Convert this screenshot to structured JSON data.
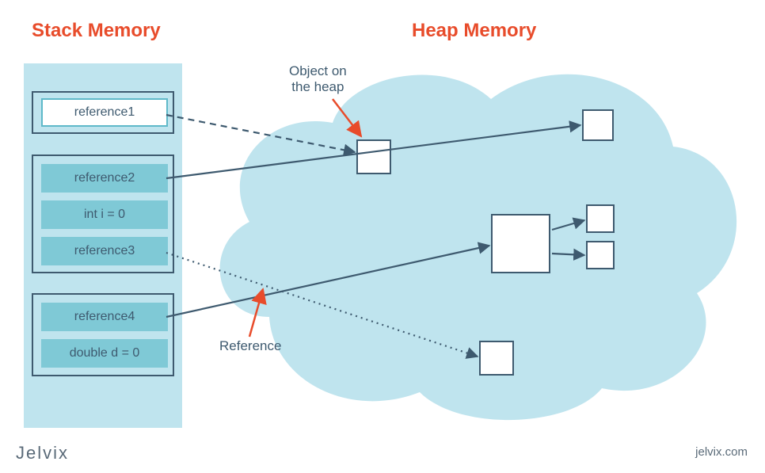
{
  "titles": {
    "stack": "Stack Memory",
    "heap": "Heap Memory"
  },
  "stack": {
    "frame1": {
      "ref1": "reference1"
    },
    "frame2": {
      "ref2": "reference2",
      "int": "int i = 0",
      "ref3": "reference3"
    },
    "frame3": {
      "ref4": "reference4",
      "dbl": "double d = 0"
    }
  },
  "annotations": {
    "object_on_heap_line1": "Object on",
    "object_on_heap_line2": "the heap",
    "reference": "Reference"
  },
  "footer": {
    "brand": "Jelvix",
    "url": "jelvix.com"
  },
  "colors": {
    "accent": "#e84c2b",
    "line": "#3e5a6f",
    "cloud": "#bfe4ee",
    "slot": "#7fc9d6"
  }
}
